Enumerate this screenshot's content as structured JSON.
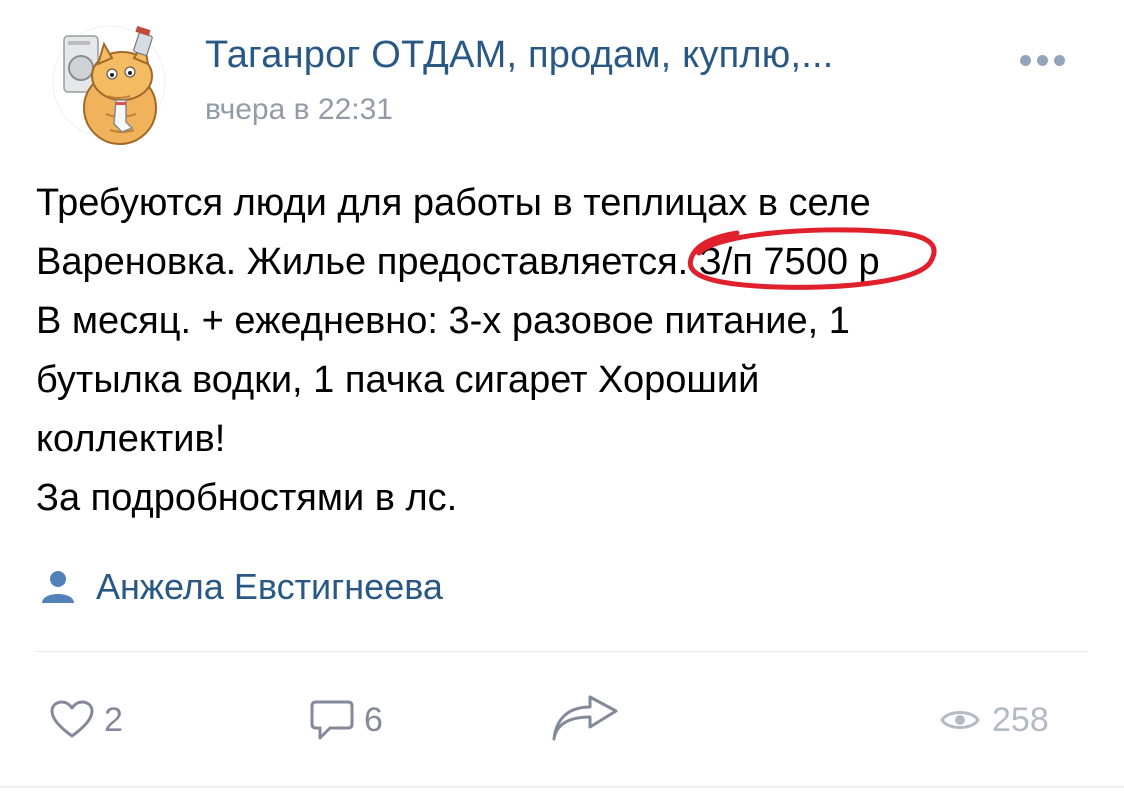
{
  "post": {
    "group_name": "Таганрог ОТДАМ, продам, куплю,...",
    "time": "вчера в 22:31",
    "text_lines": {
      "l1": "Требуются люди для работы в теплицах в селе",
      "l2_start": "Вареновка. Жилье предоставляется.",
      "l2_highlight": "З/п 7500 р",
      "l3": "В месяц. + ежедневно: 3-х разовое питание, 1",
      "l4": "бутылка водки, 1 пачка сигарет Хороший",
      "l5": "коллектив!",
      "l6": "За подробностями в лс."
    },
    "author": "Анжела Евстигнеева"
  },
  "actions": {
    "likes": "2",
    "comments": "6",
    "views": "258"
  },
  "icons": {
    "more": "more-dots-icon",
    "author": "user-icon",
    "like": "heart-icon",
    "comment": "comment-icon",
    "share": "share-arrow-icon",
    "views": "eye-icon"
  },
  "colors": {
    "link": "#2a5885",
    "secondary": "#939ba6",
    "icon": "#828a99",
    "highlight_marker": "#e0202c"
  }
}
